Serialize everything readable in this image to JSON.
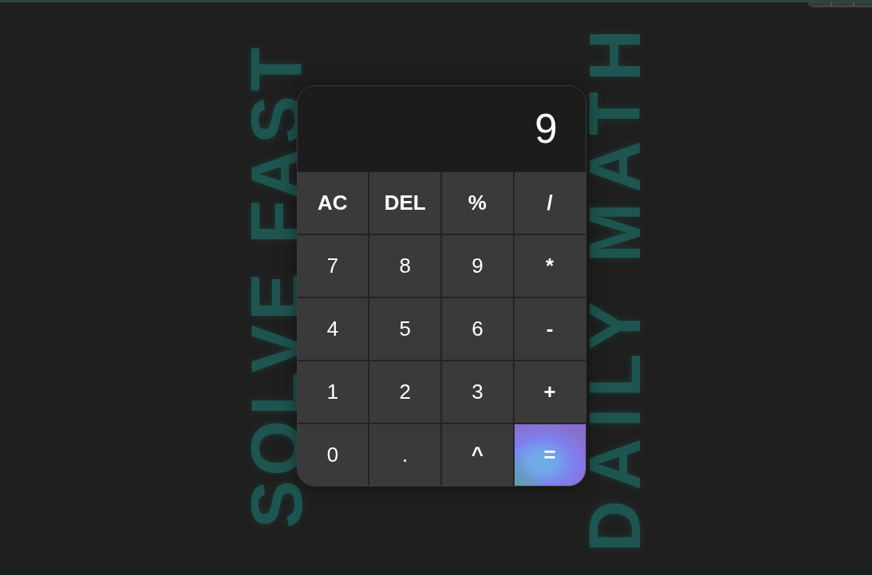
{
  "background_words": [
    "SOLVE FAST",
    "DAILY MATH"
  ],
  "calculator": {
    "display": "9",
    "keys": [
      {
        "label": "AC",
        "kind": "function"
      },
      {
        "label": "DEL",
        "kind": "function"
      },
      {
        "label": "%",
        "kind": "operator"
      },
      {
        "label": "/",
        "kind": "operator"
      },
      {
        "label": "7",
        "kind": "digit"
      },
      {
        "label": "8",
        "kind": "digit"
      },
      {
        "label": "9",
        "kind": "digit"
      },
      {
        "label": "*",
        "kind": "operator"
      },
      {
        "label": "4",
        "kind": "digit"
      },
      {
        "label": "5",
        "kind": "digit"
      },
      {
        "label": "6",
        "kind": "digit"
      },
      {
        "label": "-",
        "kind": "operator"
      },
      {
        "label": "1",
        "kind": "digit"
      },
      {
        "label": "2",
        "kind": "digit"
      },
      {
        "label": "3",
        "kind": "digit"
      },
      {
        "label": "+",
        "kind": "operator"
      },
      {
        "label": "0",
        "kind": "digit"
      },
      {
        "label": ".",
        "kind": "digit"
      },
      {
        "label": "^",
        "kind": "operator"
      },
      {
        "label": "=",
        "kind": "equals"
      }
    ]
  }
}
